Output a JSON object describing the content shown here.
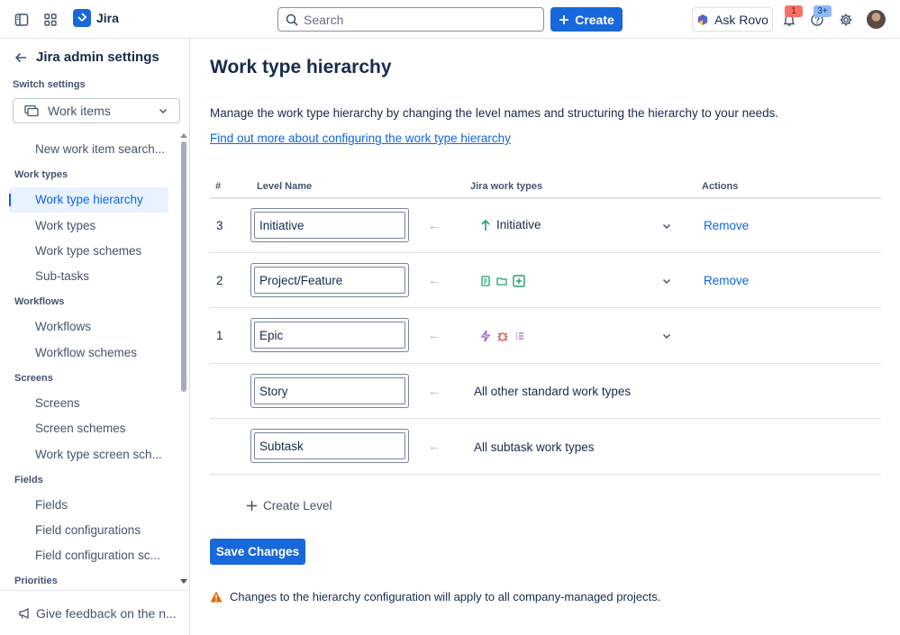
{
  "topbar": {
    "app_name": "Jira",
    "search_placeholder": "Search",
    "create_label": "Create",
    "ask_rovo_label": "Ask Rovo",
    "notifications_count": "1",
    "help_count": "3+"
  },
  "sidebar": {
    "title": "Jira admin settings",
    "switch_settings_label": "Switch settings",
    "switch_selected": "Work items",
    "items": [
      {
        "type": "item",
        "label": "New work item search..."
      },
      {
        "type": "section",
        "label": "Work types"
      },
      {
        "type": "item",
        "label": "Work type hierarchy",
        "active": true
      },
      {
        "type": "item",
        "label": "Work types"
      },
      {
        "type": "item",
        "label": "Work type schemes"
      },
      {
        "type": "item",
        "label": "Sub-tasks"
      },
      {
        "type": "section",
        "label": "Workflows"
      },
      {
        "type": "item",
        "label": "Workflows"
      },
      {
        "type": "item",
        "label": "Workflow schemes"
      },
      {
        "type": "section",
        "label": "Screens"
      },
      {
        "type": "item",
        "label": "Screens"
      },
      {
        "type": "item",
        "label": "Screen schemes"
      },
      {
        "type": "item",
        "label": "Work type screen sch..."
      },
      {
        "type": "section",
        "label": "Fields"
      },
      {
        "type": "item",
        "label": "Fields"
      },
      {
        "type": "item",
        "label": "Field configurations"
      },
      {
        "type": "item",
        "label": "Field configuration sc..."
      },
      {
        "type": "section",
        "label": "Priorities"
      }
    ],
    "feedback_label": "Give feedback on the n..."
  },
  "main": {
    "title": "Work type hierarchy",
    "description": "Manage the work type hierarchy by changing the level names and structuring the hierarchy to your needs.",
    "learn_more_link": "Find out more about configuring the work type hierarchy",
    "columns": {
      "num": "#",
      "level_name": "Level Name",
      "work_types": "Jira work types",
      "actions": "Actions"
    },
    "rows": [
      {
        "num": "3",
        "level_name": "Initiative",
        "work_types_label": "Initiative",
        "icons": [
          "arrow-up-icon"
        ],
        "action": "Remove"
      },
      {
        "num": "2",
        "level_name": "Project/Feature",
        "work_types_label": "",
        "icons": [
          "document-icon",
          "folder-icon",
          "plus-square-icon"
        ],
        "action": "Remove"
      },
      {
        "num": "1",
        "level_name": "Epic",
        "work_types_label": "",
        "icons": [
          "lightning-icon",
          "bug-icon",
          "checklist-icon"
        ],
        "action": ""
      },
      {
        "num": "",
        "level_name": "Story",
        "work_types_label": "All other standard work types",
        "icons": [],
        "action": ""
      },
      {
        "num": "",
        "level_name": "Subtask",
        "work_types_label": "All subtask work types",
        "icons": [],
        "action": ""
      }
    ],
    "create_level_label": "Create Level",
    "save_label": "Save Changes",
    "warning_text": "Changes to the hierarchy configuration will apply to all company-managed projects."
  },
  "colors": {
    "accent": "#1868db",
    "link": "#0c66e4",
    "warning": "#e56910"
  }
}
